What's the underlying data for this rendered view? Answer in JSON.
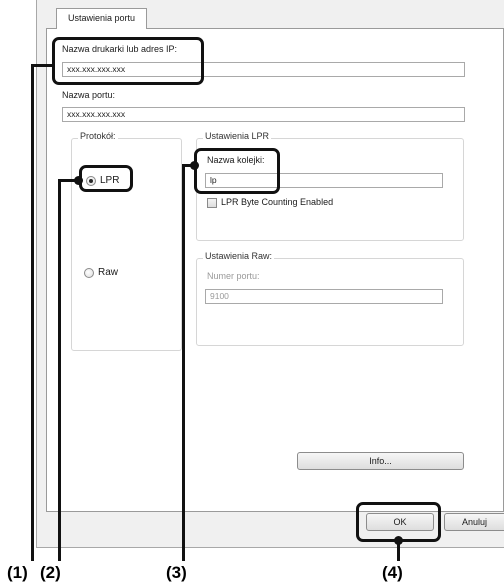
{
  "tab": {
    "label": "Ustawienia portu"
  },
  "printer_name": {
    "label": "Nazwa drukarki lub adres IP:",
    "value": "xxx.xxx.xxx.xxx"
  },
  "port_name": {
    "label": "Nazwa portu:",
    "value": "xxx.xxx.xxx.xxx"
  },
  "protocol": {
    "title": "Protokół:",
    "options": [
      {
        "label": "LPR",
        "checked": true
      },
      {
        "label": "Raw",
        "checked": false
      }
    ]
  },
  "lpr_settings": {
    "title": "Ustawienia LPR",
    "queue_label": "Nazwa kolejki:",
    "queue_value": "lp",
    "byte_counting_label": "LPR Byte Counting Enabled",
    "byte_counting_checked": false
  },
  "raw_settings": {
    "title": "Ustawienia Raw:",
    "port_label": "Numer portu:",
    "port_value": "9100"
  },
  "buttons": {
    "info": "Info...",
    "ok": "OK",
    "cancel": "Anuluj"
  },
  "markers": {
    "m1": "(1)",
    "m2": "(2)",
    "m3": "(3)",
    "m4": "(4)"
  }
}
